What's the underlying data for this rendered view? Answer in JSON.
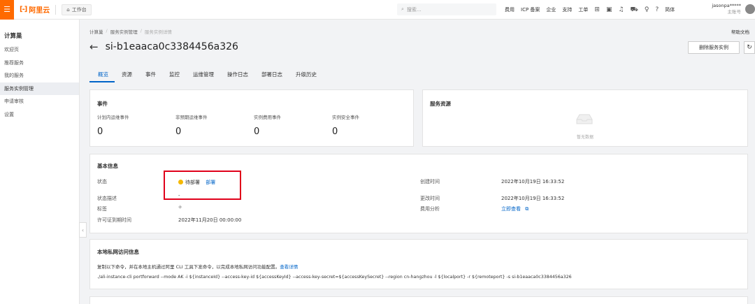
{
  "topbar": {
    "logo_text": "阿里云",
    "logo_mark": "[-]",
    "workbench": "工作台",
    "search_placeholder": "搜索...",
    "nav": [
      "费用",
      "ICP 备案",
      "企业",
      "支持",
      "工单"
    ],
    "lang": "简体",
    "username": "jasonpa*****",
    "account_type": "主账号"
  },
  "sidebar": {
    "title": "计算巢",
    "items": [
      {
        "label": "欢迎页",
        "active": false
      },
      {
        "label": "推荐服务",
        "active": false
      },
      {
        "label": "我的服务",
        "active": false
      },
      {
        "label": "服务实例管理",
        "active": true
      },
      {
        "label": "申请审核",
        "active": false
      },
      {
        "label": "设置",
        "active": false
      }
    ]
  },
  "breadcrumb": [
    "计算巢",
    "服务实例管理",
    "服务实例详情"
  ],
  "help_doc": "帮助文档",
  "page_title": "si-b1eaaca0c3384456a326",
  "delete_button": "删除服务实例",
  "tabs": [
    "概览",
    "资源",
    "事件",
    "监控",
    "运维管理",
    "操作日志",
    "部署日志",
    "升级历史"
  ],
  "events": {
    "title": "事件",
    "items": [
      {
        "label": "计划内运维事件",
        "value": "0"
      },
      {
        "label": "非预期运维事件",
        "value": "0"
      },
      {
        "label": "实例费用事件",
        "value": "0"
      },
      {
        "label": "实例安全事件",
        "value": "0"
      }
    ]
  },
  "resources": {
    "title": "服务资源",
    "empty_text": "暂无数据"
  },
  "basic": {
    "title": "基本信息",
    "status_label": "状态",
    "status_value": "待部署",
    "status_action": "部署",
    "status_desc_label": "状态描述",
    "status_desc_value": "-",
    "tags_label": "标签",
    "license_label": "许可证到期时间",
    "license_value": "2022年11月20日 00:00:00",
    "created_label": "创建时间",
    "created_value": "2022年10月19日 16:33:52",
    "modified_label": "更改时间",
    "modified_value": "2022年10月19日 16:33:52",
    "cost_label": "费用分析",
    "cost_link": "立即查看"
  },
  "private": {
    "title": "本地私网访问信息",
    "desc": "复制以下命令，并在本地主机通过阿里 CLI 工具下发命令，以完成本地私网访问功能配置。",
    "desc_link": "查看详情",
    "command": "./ali-instance-cli portforward --mode AK -i ${instanceId} --access-key-id ${accessKeyId} --access-key-secret=${accessKeySecret} --region cn-hangzhou -l ${localport} -r ${remoteport} -s si-b1eaaca0c3384456a326"
  },
  "colors": {
    "brand": "#ff6a00",
    "link": "#0064c8",
    "status_pending": "#f5b800",
    "highlight": "#e0001a"
  }
}
